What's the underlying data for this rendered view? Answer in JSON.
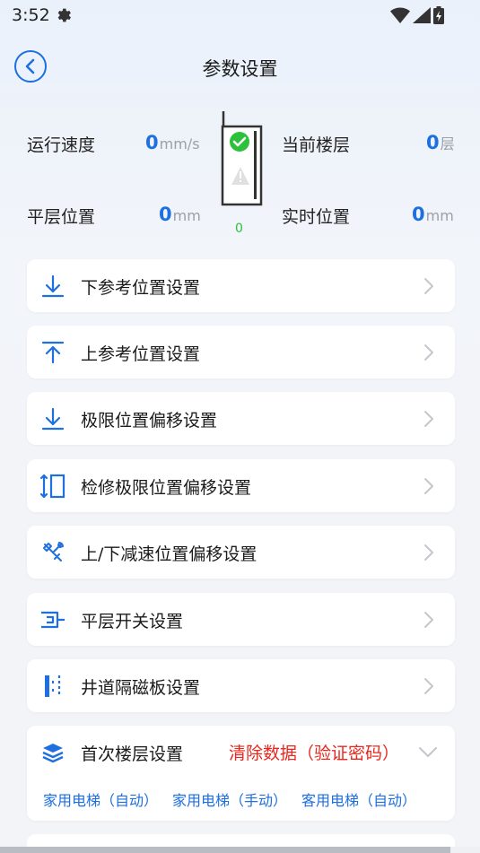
{
  "status": {
    "time": "3:52"
  },
  "header": {
    "title": "参数设置"
  },
  "info": {
    "speed_label": "运行速度",
    "speed_value": "0",
    "speed_unit": "mm/s",
    "floor_label": "当前楼层",
    "floor_value": "0",
    "floor_unit": "层",
    "level_label": "平层位置",
    "level_value": "0",
    "level_unit": "mm",
    "realtime_label": "实时位置",
    "realtime_value": "0",
    "realtime_unit": "mm",
    "elevator_number": "0"
  },
  "menu": [
    {
      "label": "下参考位置设置",
      "icon": "arrow-down-to-line-icon"
    },
    {
      "label": "上参考位置设置",
      "icon": "arrow-up-to-line-icon"
    },
    {
      "label": "极限位置偏移设置",
      "icon": "arrow-down-to-line-icon"
    },
    {
      "label": "检修极限位置偏移设置",
      "icon": "vertical-range-icon"
    },
    {
      "label": "上/下减速位置偏移设置",
      "icon": "tools-icon"
    },
    {
      "label": "平层开关设置",
      "icon": "leveling-switch-icon"
    },
    {
      "label": "井道隔磁板设置",
      "icon": "shaft-plate-icon"
    }
  ],
  "first_floor": {
    "label": "首次楼层设置",
    "warning": "清除数据（验证密码）",
    "options": [
      "家用电梯（自动）",
      "家用电梯（手动）",
      "客用电梯（自动）"
    ]
  },
  "colors": {
    "accent": "#1e6fe0",
    "warning": "#e8281e",
    "success": "#2bc13a"
  }
}
